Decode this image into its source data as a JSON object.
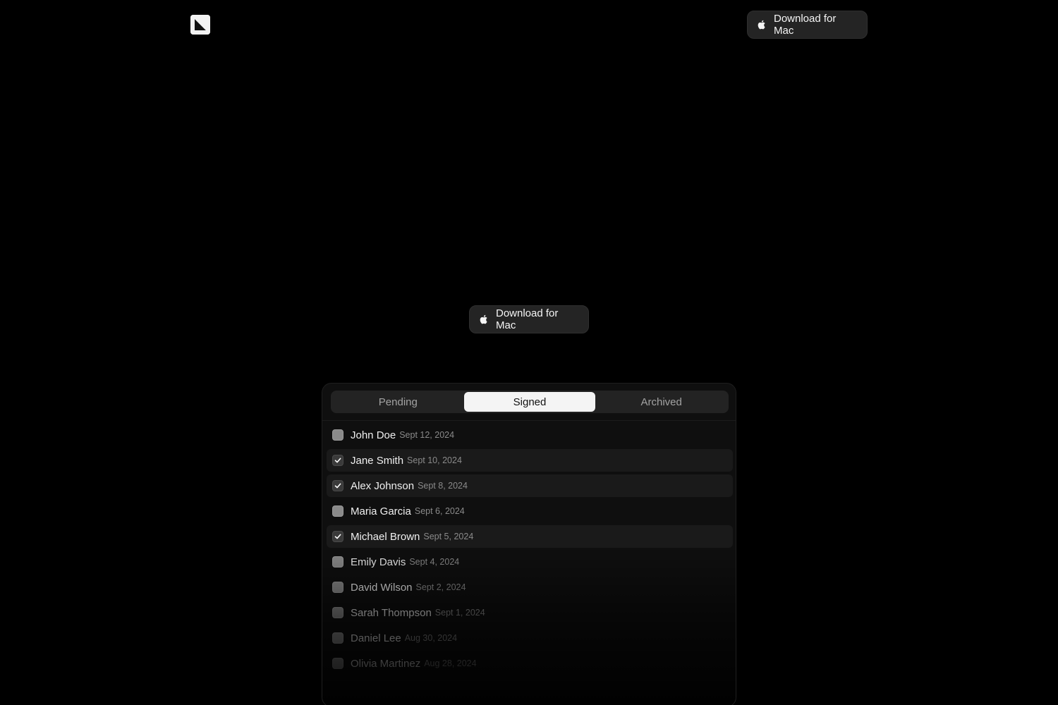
{
  "header": {
    "logo_icon": "app-logo-icon",
    "download_label": "Download for Mac"
  },
  "hero": {
    "download_label": "Download for Mac"
  },
  "panel": {
    "tabs": [
      {
        "label": "Pending",
        "active": false
      },
      {
        "label": "Signed",
        "active": true
      },
      {
        "label": "Archived",
        "active": false
      }
    ],
    "rows": [
      {
        "name": "John Doe",
        "date": "Sept 12, 2024",
        "checked": false
      },
      {
        "name": "Jane Smith",
        "date": "Sept 10, 2024",
        "checked": true
      },
      {
        "name": "Alex Johnson",
        "date": "Sept 8, 2024",
        "checked": true
      },
      {
        "name": "Maria Garcia",
        "date": "Sept 6, 2024",
        "checked": false
      },
      {
        "name": "Michael Brown",
        "date": "Sept 5, 2024",
        "checked": true
      },
      {
        "name": "Emily Davis",
        "date": "Sept 4, 2024",
        "checked": false
      },
      {
        "name": "David Wilson",
        "date": "Sept 2, 2024",
        "checked": false
      },
      {
        "name": "Sarah Thompson",
        "date": "Sept 1, 2024",
        "checked": false
      },
      {
        "name": "Daniel Lee",
        "date": "Aug 30, 2024",
        "checked": false
      },
      {
        "name": "Olivia Martinez",
        "date": "Aug 28, 2024",
        "checked": false
      }
    ]
  },
  "colors": {
    "background": "#000000",
    "button_bg": "#242424",
    "active_tab_bg": "#f4f4f4",
    "text_primary": "#f0f0f0",
    "text_muted": "#8a8a8a"
  },
  "icons": {
    "apple": "apple-icon",
    "check": "checkmark-icon"
  }
}
